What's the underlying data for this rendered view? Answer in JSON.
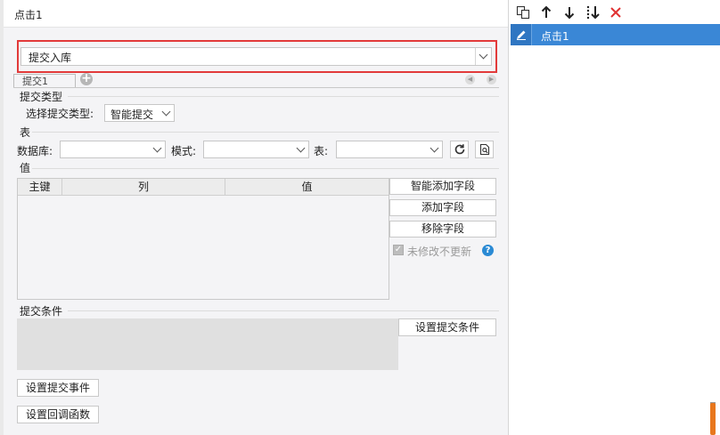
{
  "dialog": {
    "title": "点击1",
    "action_select": {
      "value": "提交入库"
    },
    "tabs": [
      {
        "label": "提交1"
      }
    ],
    "submit_type": {
      "section_label": "提交类型",
      "field_label": "选择提交类型:",
      "value": "智能提交"
    },
    "table_section": {
      "section_label": "表",
      "database_label": "数据库:",
      "database_value": "",
      "schema_label": "模式:",
      "schema_value": "",
      "table_label": "表:",
      "table_value": "",
      "refresh_icon": "refresh-icon",
      "search_icon": "search-document-icon"
    },
    "value_section": {
      "section_label": "值",
      "columns": [
        "主键",
        "列",
        "值"
      ],
      "rows": [],
      "buttons": {
        "smart_add": "智能添加字段",
        "add": "添加字段",
        "remove": "移除字段"
      },
      "no_update_checkbox": {
        "label": "未修改不更新",
        "checked": true,
        "disabled": true
      },
      "help_icon": "help-icon"
    },
    "condition_section": {
      "section_label": "提交条件",
      "set_condition_button": "设置提交条件"
    },
    "set_event_button": "设置提交事件",
    "set_callback_button": "设置回调函数"
  },
  "right_panel": {
    "toolbar_icons": [
      "copy-icon",
      "arrow-up-icon",
      "arrow-down-icon",
      "move-to-bottom-icon",
      "delete-icon"
    ],
    "items": [
      {
        "label": "点击1",
        "selected": true,
        "icon": "edit-icon"
      }
    ]
  },
  "colors": {
    "highlight_frame": "#e23a3a",
    "selection": "#3a87d6",
    "help": "#2a8ad4",
    "delete": "#e03131",
    "scroll_accent": "#e8771d"
  }
}
